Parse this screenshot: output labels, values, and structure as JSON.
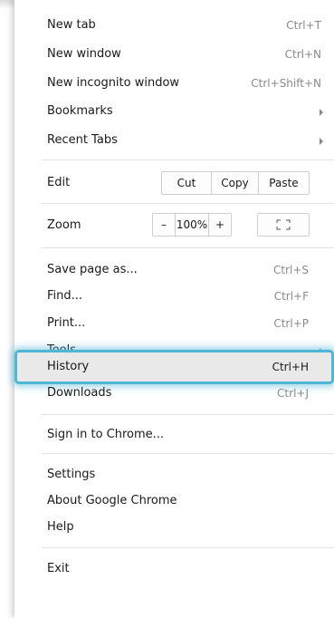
{
  "items": {
    "new_tab": {
      "label": "New tab",
      "shortcut": "Ctrl+T"
    },
    "new_window": {
      "label": "New window",
      "shortcut": "Ctrl+N"
    },
    "new_incognito": {
      "label": "New incognito window",
      "shortcut": "Ctrl+Shift+N"
    },
    "bookmarks": {
      "label": "Bookmarks"
    },
    "recent_tabs": {
      "label": "Recent Tabs"
    },
    "save_page": {
      "label": "Save page as...",
      "shortcut": "Ctrl+S"
    },
    "find": {
      "label": "Find...",
      "shortcut": "Ctrl+F"
    },
    "print": {
      "label": "Print...",
      "shortcut": "Ctrl+P"
    },
    "tools": {
      "label": "Tools"
    },
    "history": {
      "label": "History",
      "shortcut": "Ctrl+H"
    },
    "downloads": {
      "label": "Downloads",
      "shortcut": "Ctrl+J"
    },
    "sign_in": {
      "label": "Sign in to Chrome..."
    },
    "settings": {
      "label": "Settings"
    },
    "about": {
      "label": "About Google Chrome"
    },
    "help": {
      "label": "Help"
    },
    "exit": {
      "label": "Exit"
    }
  },
  "edit": {
    "label": "Edit",
    "cut": "Cut",
    "copy": "Copy",
    "paste": "Paste"
  },
  "zoom": {
    "label": "Zoom",
    "minus": "–",
    "level": "100%",
    "plus": "+",
    "fullscreen_icon": "fullscreen-icon"
  },
  "colors": {
    "highlight_border": "#4fb6d6",
    "highlight_bg": "#e9e9e9"
  }
}
